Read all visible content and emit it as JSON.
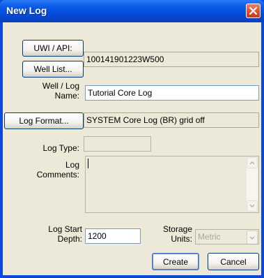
{
  "window": {
    "title": "New Log"
  },
  "buttons": {
    "uwi_api": "UWI / API:",
    "well_list": "Well List...",
    "log_format": "Log Format...",
    "create": "Create",
    "cancel": "Cancel"
  },
  "labels": {
    "well_log_name_1": "Well / Log",
    "well_log_name_2": "Name:",
    "log_type": "Log Type:",
    "log_comments_1": "Log",
    "log_comments_2": "Comments:",
    "log_start_depth_1": "Log Start",
    "log_start_depth_2": "Depth:",
    "storage_units_1": "Storage",
    "storage_units_2": "Units:"
  },
  "fields": {
    "uwi_value": "100141901223W500",
    "well_log_name": "Tutorial Core Log",
    "log_format_value": "SYSTEM Core Log (BR) grid off",
    "log_type": "",
    "log_comments": "",
    "log_start_depth": "1200",
    "storage_units": "Metric"
  }
}
